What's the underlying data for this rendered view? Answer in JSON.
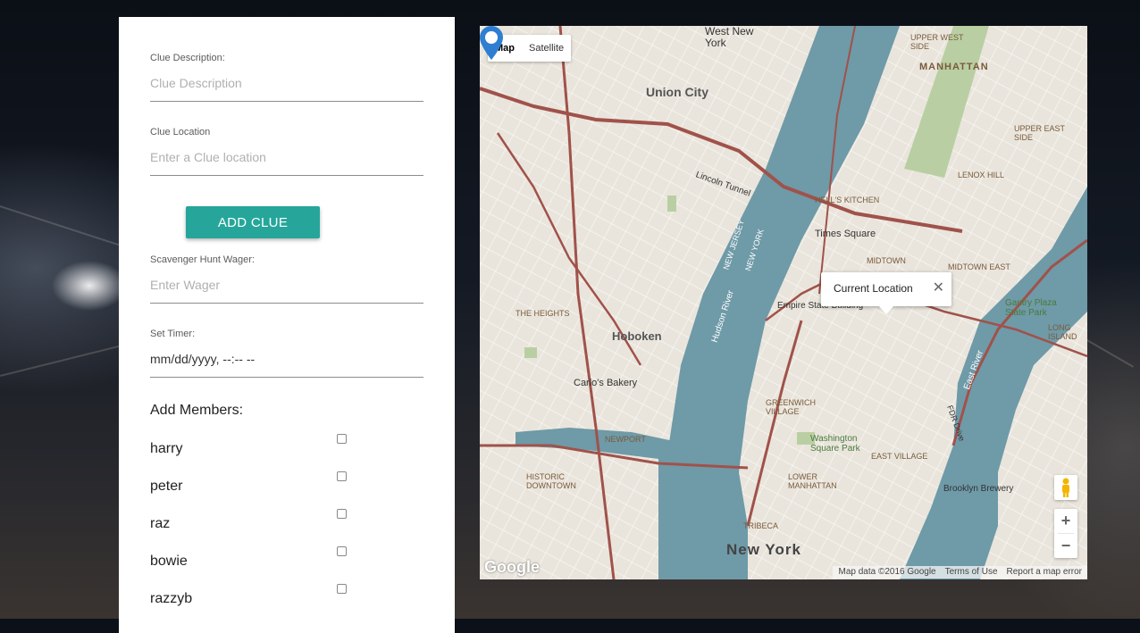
{
  "form": {
    "clue_description": {
      "label": "Clue Description:",
      "placeholder": "Clue Description"
    },
    "clue_location": {
      "label": "Clue Location",
      "placeholder": "Enter a Clue location"
    },
    "add_clue_button": "ADD CLUE",
    "wager": {
      "label": "Scavenger Hunt Wager:",
      "placeholder": "Enter Wager"
    },
    "timer": {
      "label": "Set Timer:",
      "value": "mm/dd/yyyy, --:-- --"
    },
    "members_title": "Add Members:",
    "members": [
      "harry",
      "peter",
      "raz",
      "bowie",
      "razzyb"
    ]
  },
  "map": {
    "map_type_options": [
      "Map",
      "Satellite"
    ],
    "selected_map_type": "Map",
    "info_window_text": "Current Location",
    "zoom_in": "+",
    "zoom_out": "−",
    "logo": "Google",
    "attribution": [
      "Map data ©2016 Google",
      "Terms of Use",
      "Report a map error"
    ],
    "labels": {
      "union_city": "Union City",
      "hoboken": "Hoboken",
      "new_york": "New York",
      "manhattan": "MANHATTAN",
      "upper_west_side": "UPPER WEST SIDE",
      "upper_east_side": "UPPER EAST SIDE",
      "lenox_hill": "LENOX HILL",
      "hells_kitchen": "HELL'S KITCHEN",
      "times_square": "Times Square",
      "midtown": "MIDTOWN",
      "midtown_east": "MIDTOWN EAST",
      "empire_state": "Empire State Building",
      "greenwich_village": "GREENWICH VILLAGE",
      "washington_square": "Washington Square Park",
      "east_village": "EAST VILLAGE",
      "lower_manhattan": "LOWER MANHATTAN",
      "tribeca": "TRIBECA",
      "the_heights": "THE HEIGHTS",
      "newport": "NEWPORT",
      "historic_downtown": "HISTORIC DOWNTOWN",
      "carlos_bakery": "Carlo's Bakery",
      "hudson_river": "Hudson River",
      "east_river": "East River",
      "new_jersey": "NEW JERSEY",
      "new_york_state": "NEW YORK",
      "lincoln_tunnel": "Lincoln Tunnel",
      "west_new_york": "West New York",
      "gantry_plaza": "Gantry Plaza State Park",
      "brooklyn_brewery": "Brooklyn Brewery",
      "long_island": "LONG ISLAND",
      "fdr_drive": "FDR Drive"
    }
  },
  "colors": {
    "accent": "#26a69a",
    "water": "#6f9aa8",
    "land": "#e9e5dc",
    "park": "#b9cfa3",
    "road": "#a0524a"
  }
}
